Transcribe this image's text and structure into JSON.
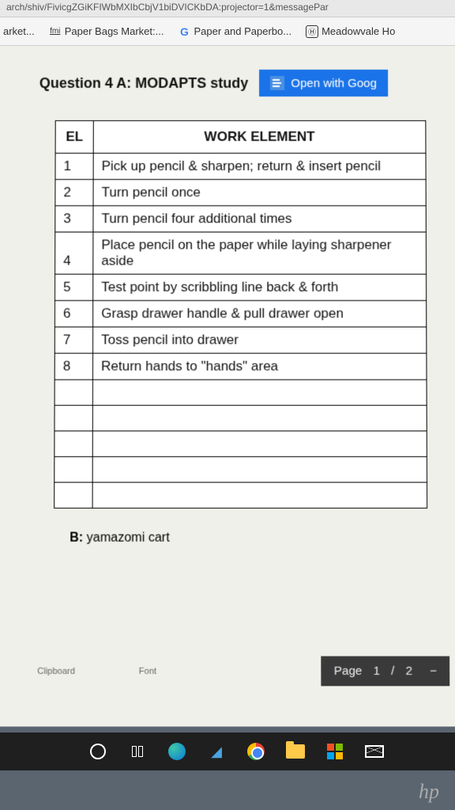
{
  "address_bar": "arch/shiv/FivicgZGiKFIWbMXIbCbjV1biDVICKbDA:projector=1&messagePar",
  "bookmarks": [
    {
      "label": "arket...",
      "icon": ""
    },
    {
      "label": "Paper Bags Market:...",
      "icon": "fmi"
    },
    {
      "label": "Paper and Paperbo...",
      "icon": "G"
    },
    {
      "label": "Meadowvale Ho",
      "icon": "H"
    }
  ],
  "doc": {
    "question_title": "Question 4 A:  MODAPTS study",
    "open_with": "Open with Goog",
    "headers": {
      "el": "EL",
      "work_element": "WORK ELEMENT"
    },
    "rows": [
      {
        "n": "1",
        "text": "Pick up pencil & sharpen; return & insert pencil"
      },
      {
        "n": "2",
        "text": "Turn pencil once"
      },
      {
        "n": "3",
        "text": "Turn pencil four additional times"
      },
      {
        "n": "4",
        "text": "Place pencil on the paper while laying sharpener aside"
      },
      {
        "n": "5",
        "text": "Test point by scribbling line back & forth"
      },
      {
        "n": "6",
        "text": "Grasp drawer handle & pull drawer open"
      },
      {
        "n": "7",
        "text": "Toss pencil into drawer"
      },
      {
        "n": "8",
        "text": "Return hands to \"hands\" area"
      }
    ],
    "section_b_label": "B:",
    "section_b_text": "yamazomi cart",
    "ribbon": {
      "clipboard": "Clipboard",
      "font": "Font"
    }
  },
  "pager": {
    "label": "Page",
    "current": "1",
    "sep": "/",
    "total": "2"
  },
  "hp": "hp"
}
